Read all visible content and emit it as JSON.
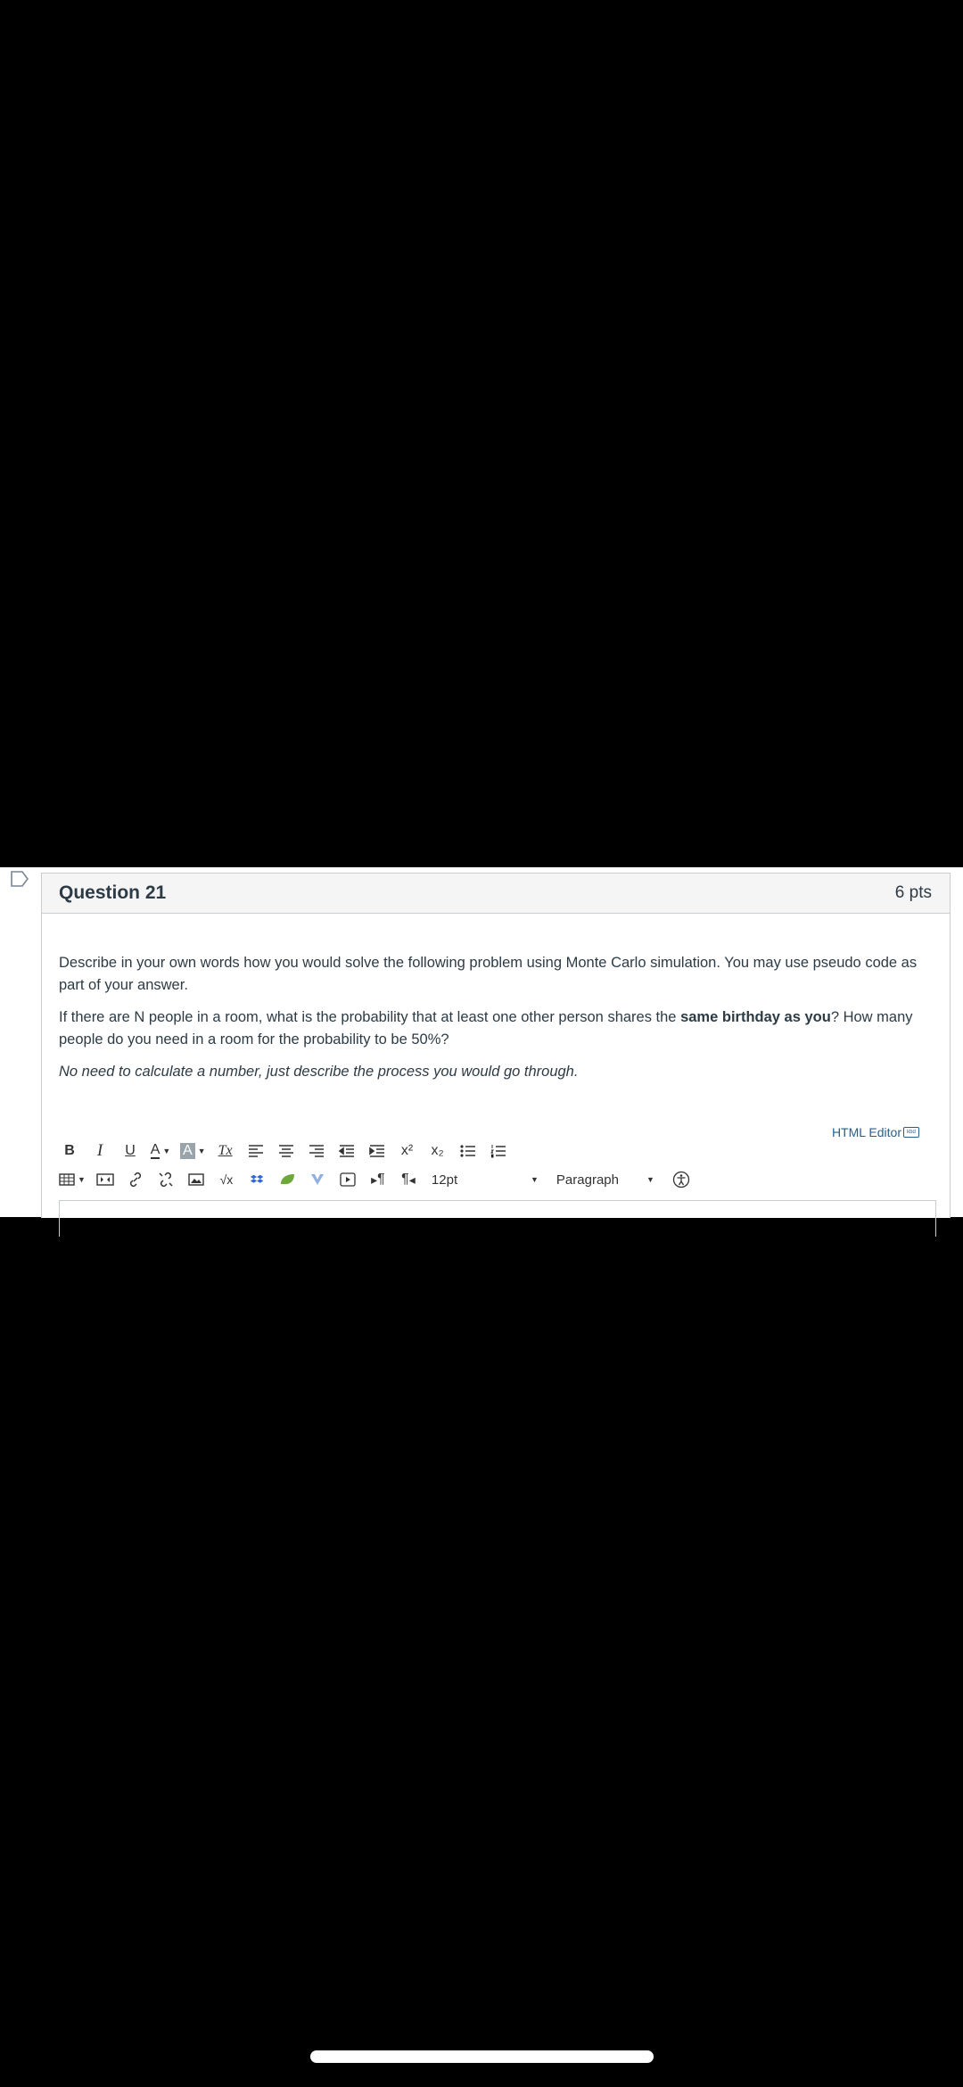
{
  "question": {
    "title": "Question 21",
    "points": "6 pts",
    "paragraph1": "Describe in your own words how you would solve the following problem using Monte Carlo simulation. You may use pseudo code as part of your answer.",
    "paragraph2_before": "If there are N people in a room, what is the probability that at least one other person shares the ",
    "paragraph2_bold": "same birthday as you",
    "paragraph2_after": "? How many people do you need in a room for the probability to be 50%?",
    "note": "No need to calculate a number, just describe the process you would go through."
  },
  "editor": {
    "html_editor_label": "HTML Editor",
    "kbd_icon_text": "kbd",
    "font_size": "12pt",
    "block_format": "Paragraph",
    "toolbar_row1": [
      "bold-icon",
      "italic-icon",
      "underline-icon",
      "text-color-icon",
      "background-color-icon",
      "clear-formatting-icon",
      "align-left-icon",
      "align-center-icon",
      "align-right-icon",
      "outdent-icon",
      "indent-icon",
      "superscript-icon",
      "subscript-icon",
      "bullet-list-icon",
      "numbered-list-icon"
    ],
    "toolbar_row2": [
      "table-icon",
      "media-icon",
      "link-icon",
      "unlink-icon",
      "image-icon",
      "math-icon",
      "dropbox-icon",
      "leaf-icon",
      "v-icon",
      "video-icon",
      "ltr-icon",
      "rtl-icon",
      "font-size-select",
      "paragraph-select",
      "accessibility-icon"
    ],
    "toolbar_glyphs": {
      "bold": "B",
      "italic": "I",
      "underline": "U",
      "text_color": "A",
      "background_color": "A",
      "clear_formatting": "Tx",
      "superscript": "x²",
      "subscript": "x₂",
      "math": "√x",
      "ltr": "¶",
      "rtl": "¶"
    }
  },
  "colors": {
    "text": "#2d3b45",
    "link": "#2a5d8f",
    "border": "#c7cdd1",
    "header_bg": "#f5f5f5"
  }
}
